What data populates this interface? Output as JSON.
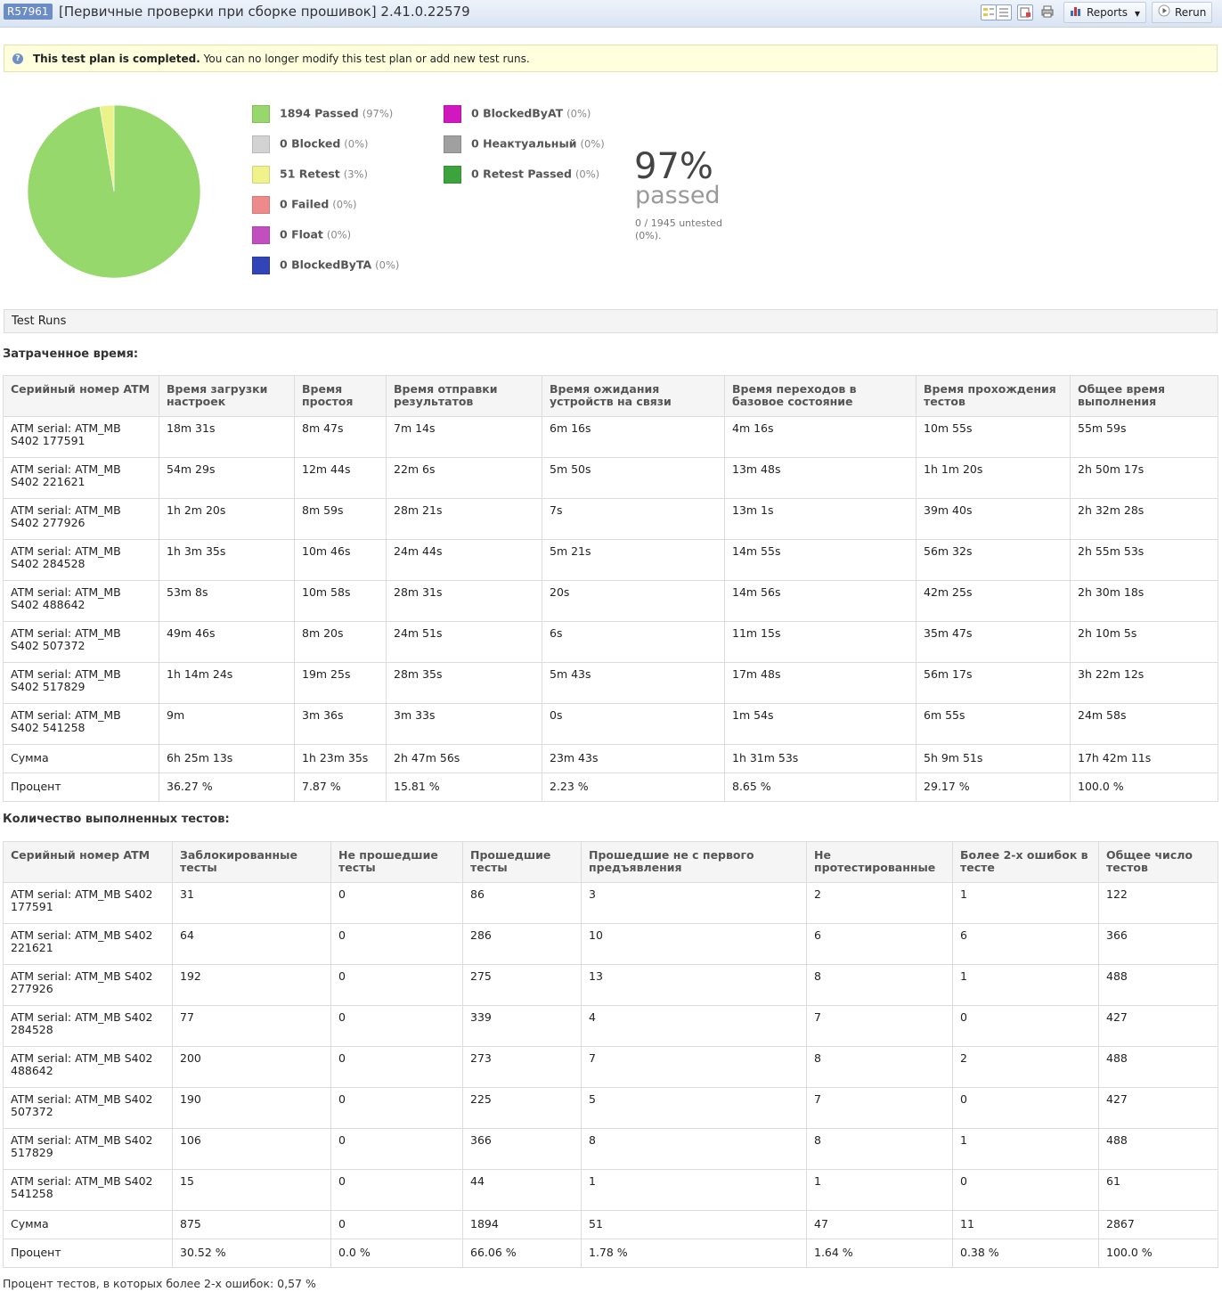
{
  "header": {
    "plan_id": "R57961",
    "title": "[Первичные проверки при сборке прошивок] 2.41.0.22579",
    "reports_label": "Reports",
    "rerun_label": "Rerun"
  },
  "notice": {
    "bold": "This test plan is completed.",
    "text": "You can no longer modify this test plan or add new test runs."
  },
  "summary": {
    "percent": "97%",
    "passed_word": "passed",
    "untested": "0 / 1945 untested (0%)."
  },
  "chart_data": {
    "type": "pie",
    "slices": [
      {
        "label": "Passed",
        "value": 1894,
        "color": "#97d86c"
      },
      {
        "label": "Retest",
        "value": 51,
        "color": "#ecf28a"
      }
    ]
  },
  "legend": [
    {
      "count": "1894",
      "name": "Passed",
      "pct": "(97%)",
      "color": "#97d86c"
    },
    {
      "count": "0",
      "name": "Blocked",
      "pct": "(0%)",
      "color": "#d3d3d3"
    },
    {
      "count": "51",
      "name": "Retest",
      "pct": "(3%)",
      "color": "#f0f28c"
    },
    {
      "count": "0",
      "name": "Failed",
      "pct": "(0%)",
      "color": "#ef8a8a"
    },
    {
      "count": "0",
      "name": "Float",
      "pct": "(0%)",
      "color": "#c24fbf"
    },
    {
      "count": "0",
      "name": "BlockedByTA",
      "pct": "(0%)",
      "color": "#3145b8"
    },
    {
      "count": "0",
      "name": "BlockedByAT",
      "pct": "(0%)",
      "color": "#d118be"
    },
    {
      "count": "0",
      "name": "Неактуальный",
      "pct": "(0%)",
      "color": "#a0a0a0"
    },
    {
      "count": "0",
      "name": "Retest Passed",
      "pct": "(0%)",
      "color": "#3da43d"
    }
  ],
  "test_runs_label": "Test Runs",
  "time_section": {
    "title": "Затраченное время:",
    "headers": [
      "Серийный номер ATM",
      "Время загрузки настроек",
      "Время простоя",
      "Время отправки результатов",
      "Время ожидания устройств на связи",
      "Время переходов в базовое состояние",
      "Время прохождения тестов",
      "Общее время выполнения"
    ],
    "rows": [
      [
        "ATM serial: ATM_MB S402 177591",
        "18m 31s",
        "8m 47s",
        "7m 14s",
        "6m 16s",
        "4m 16s",
        "10m 55s",
        "55m 59s"
      ],
      [
        "ATM serial: ATM_MB S402 221621",
        "54m 29s",
        "12m 44s",
        "22m 6s",
        "5m 50s",
        "13m 48s",
        "1h 1m 20s",
        "2h 50m 17s"
      ],
      [
        "ATM serial: ATM_MB S402 277926",
        "1h 2m 20s",
        "8m 59s",
        "28m 21s",
        "7s",
        "13m 1s",
        "39m 40s",
        "2h 32m 28s"
      ],
      [
        "ATM serial: ATM_MB S402 284528",
        "1h 3m 35s",
        "10m 46s",
        "24m 44s",
        "5m 21s",
        "14m 55s",
        "56m 32s",
        "2h 55m 53s"
      ],
      [
        "ATM serial: ATM_MB S402 488642",
        "53m 8s",
        "10m 58s",
        "28m 31s",
        "20s",
        "14m 56s",
        "42m 25s",
        "2h 30m 18s"
      ],
      [
        "ATM serial: ATM_MB S402 507372",
        "49m 46s",
        "8m 20s",
        "24m 51s",
        "6s",
        "11m 15s",
        "35m 47s",
        "2h 10m 5s"
      ],
      [
        "ATM serial: ATM_MB S402 517829",
        "1h 14m 24s",
        "19m 25s",
        "28m 35s",
        "5m 43s",
        "17m 48s",
        "56m 17s",
        "3h 22m 12s"
      ],
      [
        "ATM serial: ATM_MB S402 541258",
        "9m",
        "3m 36s",
        "3m 33s",
        "0s",
        "1m 54s",
        "6m 55s",
        "24m 58s"
      ]
    ],
    "totals": [
      [
        "Сумма",
        "6h 25m 13s",
        "1h 23m 35s",
        "2h 47m 56s",
        "23m 43s",
        "1h 31m 53s",
        "5h 9m 51s",
        "17h 42m 11s"
      ],
      [
        "Процент",
        "36.27 %",
        "7.87 %",
        "15.81 %",
        "2.23 %",
        "8.65 %",
        "29.17 %",
        "100.0 %"
      ]
    ]
  },
  "count_section": {
    "title": "Количество выполненных тестов:",
    "headers": [
      "Серийный номер ATM",
      "Заблокированные тесты",
      "Не прошедшие тесты",
      "Прошедшие тесты",
      "Прошедшие не с первого предъявления",
      "Не протестированные",
      "Более 2-х ошибок в тесте",
      "Общее число тестов"
    ],
    "rows": [
      [
        "ATM serial: ATM_MB S402 177591",
        "31",
        "0",
        "86",
        "3",
        "2",
        "1",
        "122"
      ],
      [
        "ATM serial: ATM_MB S402 221621",
        "64",
        "0",
        "286",
        "10",
        "6",
        "6",
        "366"
      ],
      [
        "ATM serial: ATM_MB S402 277926",
        "192",
        "0",
        "275",
        "13",
        "8",
        "1",
        "488"
      ],
      [
        "ATM serial: ATM_MB S402 284528",
        "77",
        "0",
        "339",
        "4",
        "7",
        "0",
        "427"
      ],
      [
        "ATM serial: ATM_MB S402 488642",
        "200",
        "0",
        "273",
        "7",
        "8",
        "2",
        "488"
      ],
      [
        "ATM serial: ATM_MB S402 507372",
        "190",
        "0",
        "225",
        "5",
        "7",
        "0",
        "427"
      ],
      [
        "ATM serial: ATM_MB S402 517829",
        "106",
        "0",
        "366",
        "8",
        "8",
        "1",
        "488"
      ],
      [
        "ATM serial: ATM_MB S402 541258",
        "15",
        "0",
        "44",
        "1",
        "1",
        "0",
        "61"
      ]
    ],
    "totals": [
      [
        "Сумма",
        "875",
        "0",
        "1894",
        "51",
        "47",
        "11",
        "2867"
      ],
      [
        "Процент",
        "30.52 %",
        "0.0 %",
        "66.06 %",
        "1.78 %",
        "1.64 %",
        "0.38 %",
        "100.0 %"
      ]
    ]
  },
  "footer_note": "Процент тестов, в которых более 2-х ошибок: 0,57 %"
}
